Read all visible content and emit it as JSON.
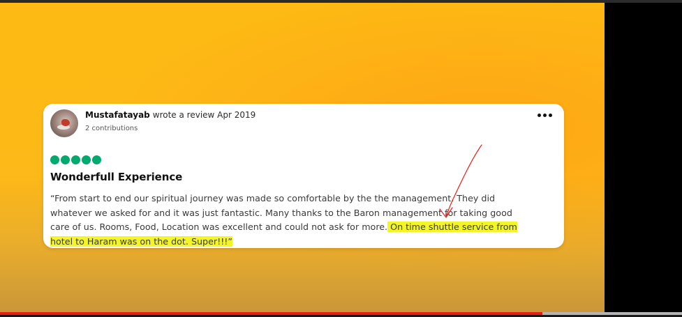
{
  "video": {
    "progress": 0.795
  },
  "review": {
    "username": "Mustafatayab",
    "wrote_text": "wrote a review Apr 2019",
    "contributions": "2 contributions",
    "rating": 5,
    "title": "Wonderfull Experience",
    "body_lines": [
      "“From start to end our spiritual journey was made so comfortable by the the management. They did",
      "whatever we asked for and it was just fantastic. Many thanks to the Baron management for taking good"
    ],
    "line3_plain": "care of us. Rooms, Food, Location was excellent and could not ask for more.",
    "line3_highlight": " On time shuttle service from",
    "line4_highlight": "hotel to Haram was on the dot. Super!!!”"
  },
  "colors": {
    "rating_green": "#00aa6c",
    "highlight_yellow": "#f3f526",
    "annotation_red": "#e8201a",
    "progress_red": "#e52013"
  }
}
